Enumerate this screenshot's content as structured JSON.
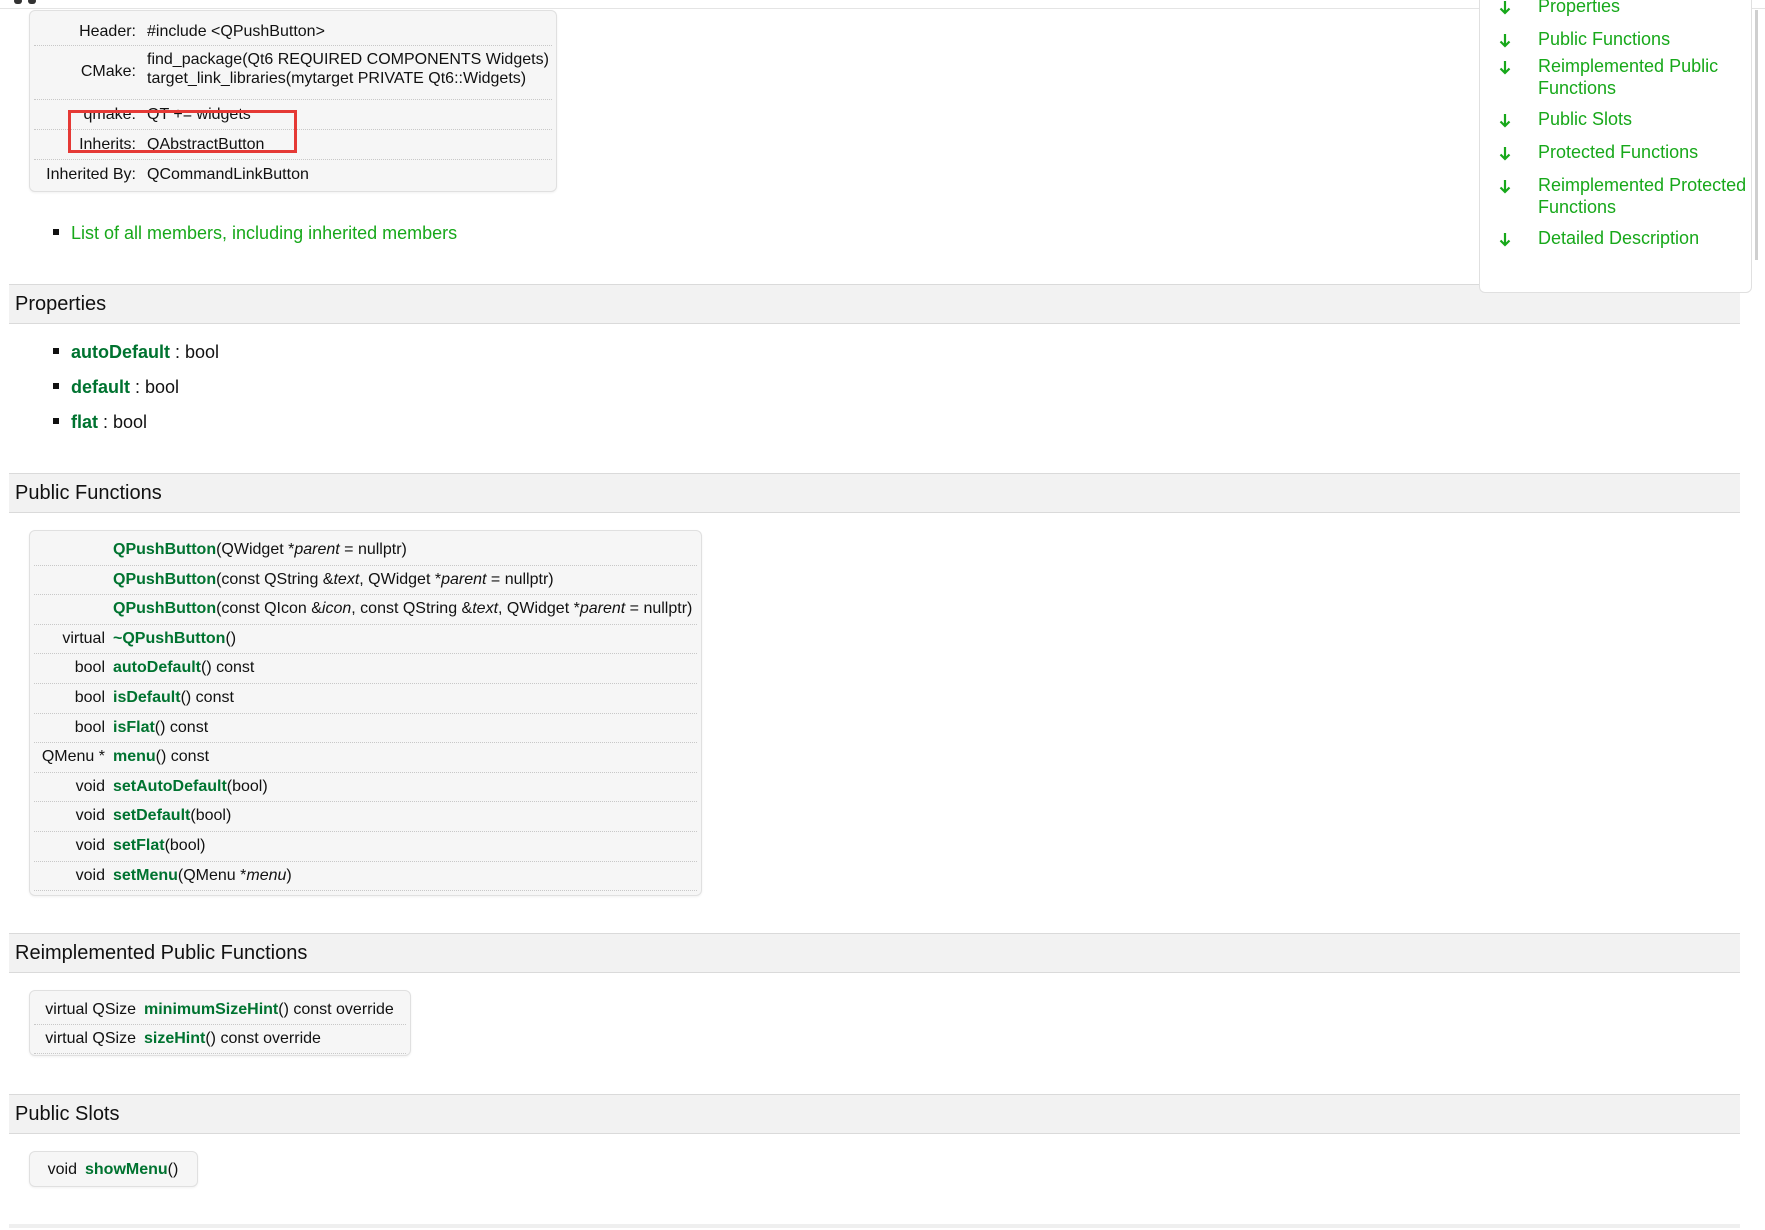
{
  "info": {
    "rows": [
      {
        "key": "Header:",
        "value": "#include <QPushButton>"
      },
      {
        "key": "CMake:",
        "value": "find_package(Qt6 REQUIRED COMPONENTS Widgets)",
        "value2": "target_link_libraries(mytarget PRIVATE Qt6::Widgets)"
      },
      {
        "key": "qmake:",
        "value": "QT += widgets"
      },
      {
        "key": "Inherits:",
        "value": "QAbstractButton"
      },
      {
        "key": "Inherited By:",
        "value": "QCommandLinkButton"
      }
    ]
  },
  "all_members_link": "List of all members, including inherited members",
  "sections": {
    "properties": "Properties",
    "public_functions": "Public Functions",
    "reimplemented_public": "Reimplemented Public Functions",
    "public_slots": "Public Slots"
  },
  "properties": [
    {
      "name": "autoDefault",
      "type": " : bool"
    },
    {
      "name": "default",
      "type": " : bool"
    },
    {
      "name": "flat",
      "type": " : bool"
    }
  ],
  "public_functions": [
    {
      "ret": "",
      "name": "QPushButton",
      "args": [
        "(QWidget *",
        "parent",
        " = nullptr)"
      ]
    },
    {
      "ret": "",
      "name": "QPushButton",
      "args": [
        "(const QString &",
        "text",
        ", QWidget *",
        "parent",
        " = nullptr)"
      ]
    },
    {
      "ret": "",
      "name": "QPushButton",
      "args": [
        "(const QIcon &",
        "icon",
        ", const QString &",
        "text",
        ", QWidget *",
        "parent",
        " = nullptr)"
      ]
    },
    {
      "ret": "virtual",
      "name": "~QPushButton",
      "args": [
        "()"
      ]
    },
    {
      "ret": "bool",
      "name": "autoDefault",
      "args": [
        "() const"
      ]
    },
    {
      "ret": "bool",
      "name": "isDefault",
      "args": [
        "() const"
      ]
    },
    {
      "ret": "bool",
      "name": "isFlat",
      "args": [
        "() const"
      ]
    },
    {
      "ret": "QMenu *",
      "name": "menu",
      "args": [
        "() const"
      ]
    },
    {
      "ret": "void",
      "name": "setAutoDefault",
      "args": [
        "(bool)"
      ]
    },
    {
      "ret": "void",
      "name": "setDefault",
      "args": [
        "(bool)"
      ]
    },
    {
      "ret": "void",
      "name": "setFlat",
      "args": [
        "(bool)"
      ]
    },
    {
      "ret": "void",
      "name": "setMenu",
      "args": [
        "(QMenu *",
        "menu",
        ")"
      ]
    }
  ],
  "reimplemented_public": [
    {
      "ret": "virtual QSize",
      "name": "minimumSizeHint",
      "args": [
        "() const override"
      ]
    },
    {
      "ret": "virtual QSize",
      "name": "sizeHint",
      "args": [
        "() const override"
      ]
    }
  ],
  "public_slots": [
    {
      "ret": "void",
      "name": "showMenu",
      "args": [
        "()"
      ]
    }
  ],
  "toc": [
    "Properties",
    "Public Functions",
    "Reimplemented Public Functions",
    "Public Slots",
    "Protected Functions",
    "Reimplemented Protected Functions",
    "Detailed Description"
  ],
  "colors": {
    "link": "#17a81a",
    "link_bold": "#007330",
    "highlight": "#e53935"
  }
}
